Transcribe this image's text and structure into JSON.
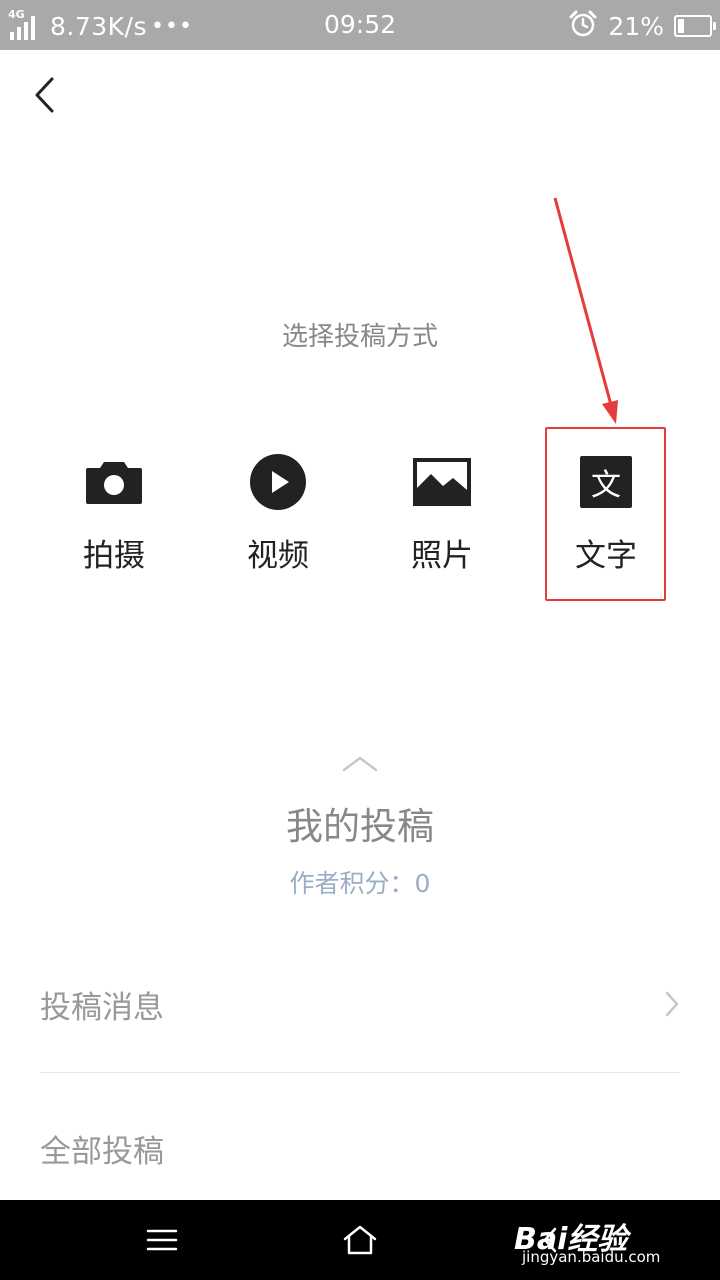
{
  "status_bar": {
    "network": "4G",
    "speed": "8.73K/s",
    "more": "•••",
    "time": "09:52",
    "battery": "21%",
    "battery_level": 0.21
  },
  "header": {
    "back_icon": "chevron-left-icon"
  },
  "post_type": {
    "title": "选择投稿方式",
    "options": [
      {
        "label": "拍摄",
        "icon": "camera-icon"
      },
      {
        "label": "视频",
        "icon": "play-circle-icon"
      },
      {
        "label": "照片",
        "icon": "image-icon"
      },
      {
        "label": "文字",
        "icon": "text-icon",
        "icon_text": "文"
      }
    ],
    "highlight_color": "#e43c3c"
  },
  "my_posts": {
    "title": "我的投稿",
    "score": "作者积分：0",
    "rows": [
      {
        "label": "投稿消息"
      },
      {
        "label": "全部投稿"
      }
    ]
  },
  "nav_bar": {
    "icons": [
      "menu-icon",
      "home-icon",
      "back-icon"
    ]
  },
  "watermark": {
    "brand": "Bai经验",
    "url": "jingyan.baidu.com"
  }
}
